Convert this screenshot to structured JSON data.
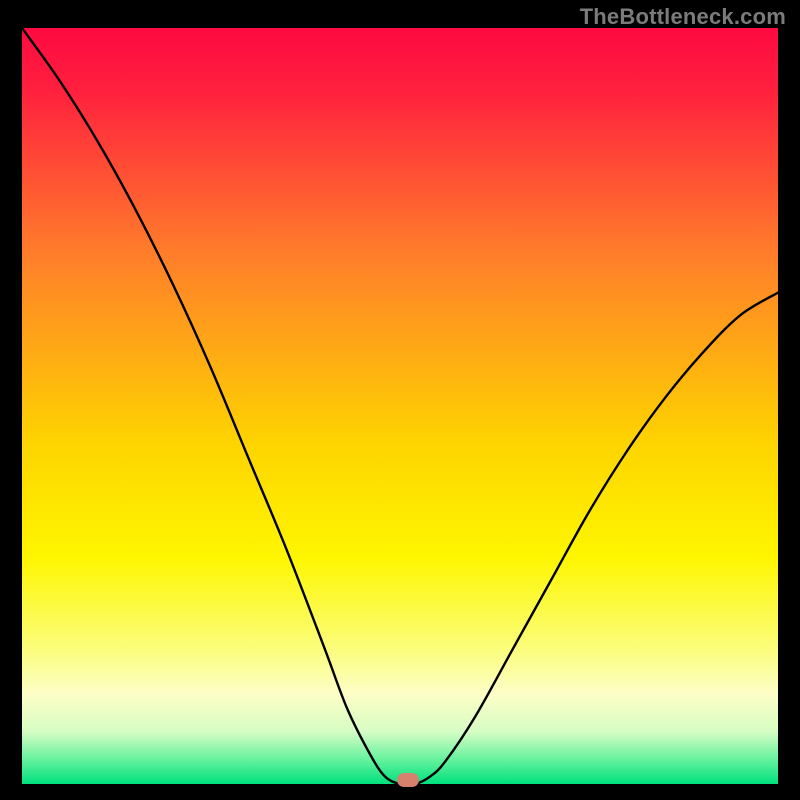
{
  "watermark": "TheBottleneck.com",
  "colors": {
    "gradient_top": "#fe0a40",
    "gradient_mid_upper": "#fe7f2a",
    "gradient_mid": "#fef600",
    "gradient_band": "#fdfec0",
    "gradient_low": "#b6fcb0",
    "gradient_bottom": "#00e17e",
    "curve": "#000000",
    "marker": "#d6806e",
    "frame": "#000000"
  },
  "chart_data": {
    "type": "line",
    "title": "",
    "xlabel": "",
    "ylabel": "",
    "xlim": [
      0,
      100
    ],
    "ylim": [
      0,
      100
    ],
    "grid": false,
    "background_gradient": [
      "#fe0a40",
      "#fef600",
      "#00e17e"
    ],
    "series": [
      {
        "name": "bottleneck-curve",
        "x": [
          0,
          5,
          10,
          15,
          20,
          25,
          30,
          35,
          40,
          43,
          46,
          48,
          50,
          52,
          54,
          56,
          60,
          65,
          70,
          75,
          80,
          85,
          90,
          95,
          100
        ],
        "y": [
          100,
          93,
          85,
          76,
          66,
          55,
          43,
          31,
          18,
          10,
          4,
          1,
          0,
          0,
          1,
          3,
          9,
          18,
          27,
          36,
          44,
          51,
          57,
          62,
          65
        ]
      }
    ],
    "flat_minimum": {
      "x_start": 48,
      "x_end": 53,
      "y": 0
    },
    "marker": {
      "x": 51,
      "y": 0.5,
      "color": "#d6806e"
    },
    "annotations": []
  }
}
